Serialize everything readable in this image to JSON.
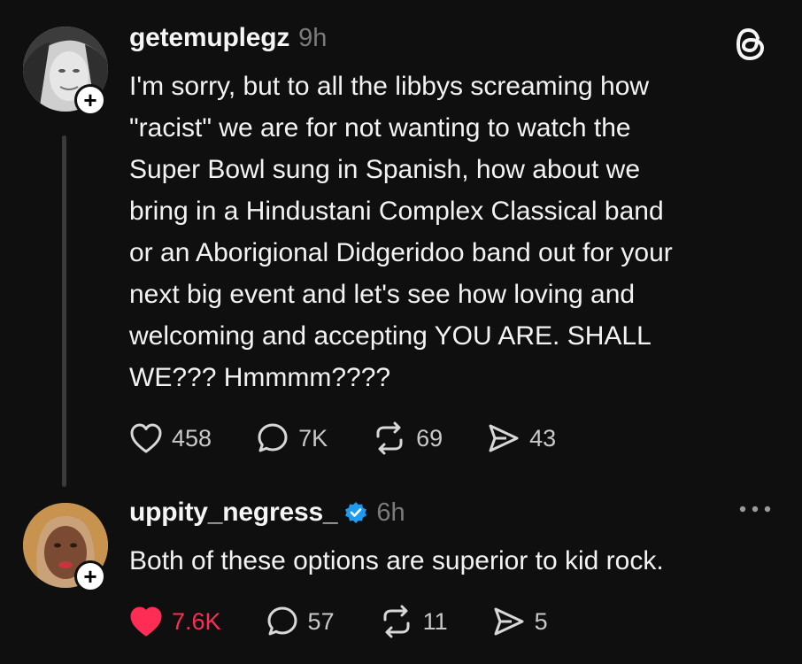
{
  "posts": [
    {
      "username": "getemuplegz",
      "time": "9h",
      "text": "I'm sorry, but to all the libbys screaming how\n\"racist\" we are for not wanting to watch the\nSuper Bowl sung in Spanish, how about we\nbring in  a Hindustani Complex Classical band\nor an Aborigional Didgeridoo band out for your\nnext big event and let's see how loving and\nwelcoming and accepting YOU ARE. SHALL\nWE??? Hmmmm????",
      "likes": "458",
      "replies": "7K",
      "reposts": "69",
      "shares": "43",
      "liked": false
    },
    {
      "username": "uppity_negress_",
      "time": "6h",
      "verified": true,
      "text": "Both of these options are superior to kid rock.",
      "likes": "7.6K",
      "replies": "57",
      "reposts": "11",
      "shares": "5",
      "liked": true
    }
  ],
  "icons": {
    "app": "threads-logo-icon",
    "follow": "plus-icon",
    "like": "heart-icon",
    "reply": "comment-bubble-icon",
    "repost": "repost-icon",
    "share": "send-icon",
    "more": "more-icon",
    "verified": "verified-badge-icon"
  },
  "colors": {
    "background": "#0f0f0f",
    "liked": "#ff2d55",
    "verified": "#1d9bf0",
    "muted": "#7b7b7b"
  }
}
